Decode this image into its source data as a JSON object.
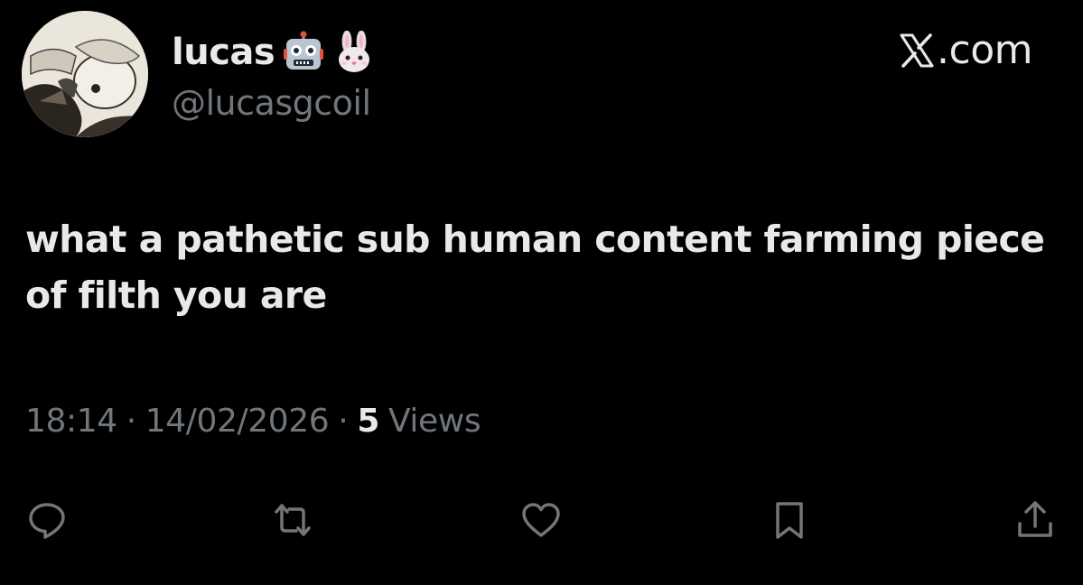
{
  "author": {
    "display_name": "lucas",
    "handle": "@lucasgcoil",
    "name_emojis": [
      "robot-emoji",
      "rabbit-emoji"
    ]
  },
  "site": {
    "label": ".com",
    "logo": "x-logo-icon"
  },
  "tweet": {
    "text": "what a pathetic sub human content farming piece of filth you are",
    "time": "18:14",
    "separator": "·",
    "date": "14/02/2026",
    "views_count": "5",
    "views_label": "Views"
  },
  "actions": [
    {
      "name": "reply-icon"
    },
    {
      "name": "retweet-icon"
    },
    {
      "name": "like-icon"
    },
    {
      "name": "bookmark-icon"
    },
    {
      "name": "share-icon"
    }
  ],
  "colors": {
    "background": "#000000",
    "primary_text": "#e7e9ea",
    "secondary_text": "#71767b"
  }
}
